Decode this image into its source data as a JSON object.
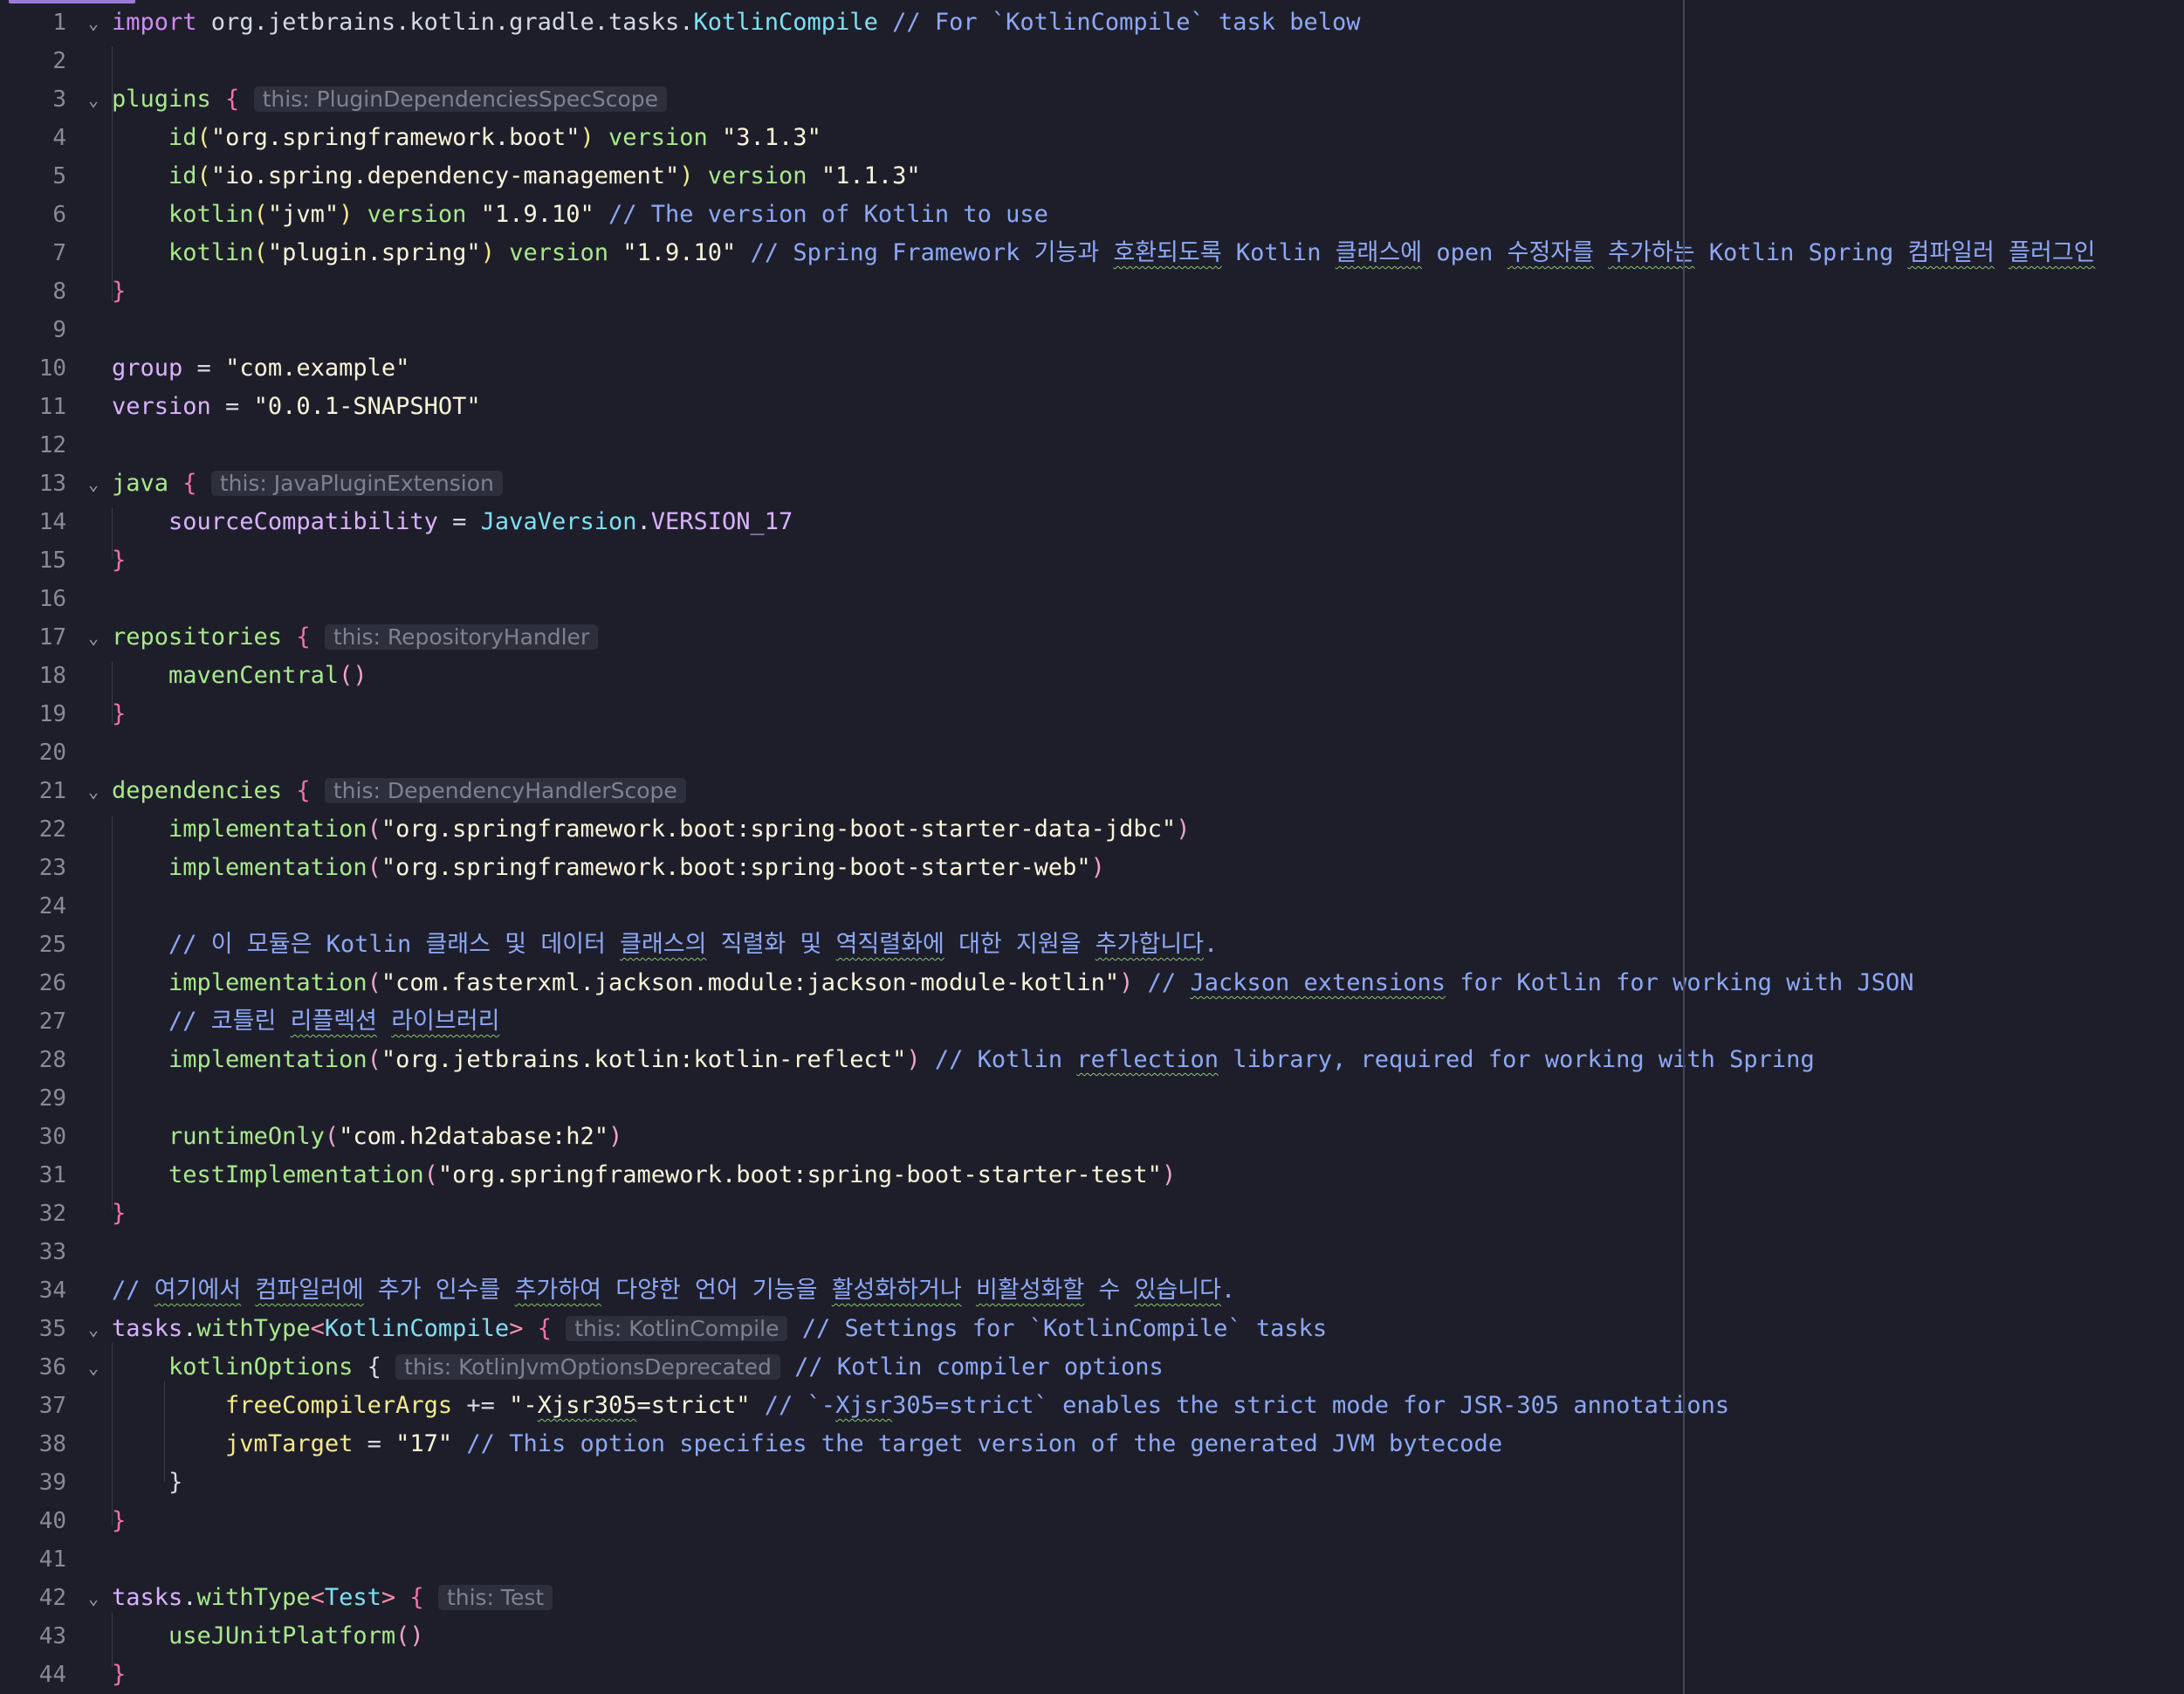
{
  "editor": {
    "line_numbers": [
      "1",
      "2",
      "3",
      "4",
      "5",
      "6",
      "7",
      "8",
      "9",
      "10",
      "11",
      "12",
      "13",
      "14",
      "15",
      "16",
      "17",
      "18",
      "19",
      "20",
      "21",
      "22",
      "23",
      "24",
      "25",
      "26",
      "27",
      "28",
      "29",
      "30",
      "31",
      "32",
      "33",
      "34",
      "35",
      "36",
      "37",
      "38",
      "39",
      "40",
      "41",
      "42",
      "43",
      "44"
    ],
    "code": {
      "l1": {
        "kw": "import",
        "pkg": " org.jetbrains.kotlin.gradle.tasks.",
        "cls": "KotlinCompile",
        "cm": " // For `KotlinCompile` task below"
      },
      "l3": {
        "name": "plugins",
        "brace": " {",
        "hint": "this: PluginDependenciesSpecScope"
      },
      "l4": {
        "fn": "id",
        "po": "(",
        "str": "\"org.springframework.boot\"",
        "pc": ")",
        "kw": " version ",
        "ver": "\"3.1.3\""
      },
      "l5": {
        "fn": "id",
        "po": "(",
        "str": "\"io.spring.dependency-management\"",
        "pc": ")",
        "kw": " version ",
        "ver": "\"1.1.3\""
      },
      "l6": {
        "fn": "kotlin",
        "po": "(",
        "str": "\"jvm\"",
        "pc": ")",
        "kw": " version ",
        "ver": "\"1.9.10\"",
        "cm": " // The version of Kotlin to use"
      },
      "l7": {
        "fn": "kotlin",
        "po": "(",
        "str": "\"plugin.spring\"",
        "pc": ")",
        "kw": " version ",
        "ver": "\"1.9.10\"",
        "c1": " // Spring Framework 기능과 ",
        "w1": "호환되도록",
        "c2": " Kotlin ",
        "w2": "클래스에",
        "c3": " open ",
        "w3": "수정자를",
        "c4": " ",
        "w4": "추가하는",
        "c5": " Kotlin Spring ",
        "w5": "컴파일러",
        "c6": " ",
        "w6": "플러그인"
      },
      "l8": {
        "brace": "}"
      },
      "l10": {
        "prop": "group",
        "eq": " = ",
        "str": "\"com.example\""
      },
      "l11": {
        "prop": "version",
        "eq": " = ",
        "str": "\"0.0.1-SNAPSHOT\""
      },
      "l13": {
        "name": "java",
        "brace": " {",
        "hint": "this: JavaPluginExtension"
      },
      "l14": {
        "prop": "sourceCompatibility",
        "eq": " = ",
        "cls": "JavaVersion",
        "dot": ".",
        "const": "VERSION_17"
      },
      "l15": {
        "brace": "}"
      },
      "l17": {
        "name": "repositories",
        "brace": " {",
        "hint": "this: RepositoryHandler"
      },
      "l18": {
        "fn": "mavenCentral",
        "parens": "()"
      },
      "l19": {
        "brace": "}"
      },
      "l21": {
        "name": "dependencies",
        "brace": " {",
        "hint": "this: DependencyHandlerScope"
      },
      "l22": {
        "fn": "implementation",
        "po": "(",
        "str": "\"org.springframework.boot:spring-boot-starter-data-jdbc\"",
        "pc": ")"
      },
      "l23": {
        "fn": "implementation",
        "po": "(",
        "str": "\"org.springframework.boot:spring-boot-starter-web\"",
        "pc": ")"
      },
      "l25": {
        "c1": "// 이 모듈은 Kotlin 클래스 및 데이터 ",
        "w1": "클래스의",
        "c2": " 직렬화 및 ",
        "w2": "역직렬화에",
        "c3": " 대한 지원을 ",
        "w3": "추가합니다",
        "c4": "."
      },
      "l26": {
        "fn": "implementation",
        "po": "(",
        "str": "\"com.fasterxml.jackson.module:jackson-module-kotlin\"",
        "pc": ")",
        "c1": " // ",
        "w1": "Jackson extensions",
        "c2": " for Kotlin for working with JSON"
      },
      "l27": {
        "c1": "// 코틀린 ",
        "w1": "리플렉션",
        "c2": " ",
        "w2": "라이브러리"
      },
      "l28": {
        "fn": "implementation",
        "po": "(",
        "str": "\"org.jetbrains.kotlin:kotlin-reflect\"",
        "pc": ")",
        "c1": " // Kotlin ",
        "w1": "reflection",
        "c2": " library, required for working with Spring"
      },
      "l30": {
        "fn": "runtimeOnly",
        "po": "(",
        "str": "\"com.h2database:h2\"",
        "pc": ")"
      },
      "l31": {
        "fn": "testImplementation",
        "po": "(",
        "str": "\"org.springframework.boot:spring-boot-starter-test\"",
        "pc": ")"
      },
      "l32": {
        "brace": "}"
      },
      "l34": {
        "c1": "// ",
        "w1": "여기에서",
        "c2": " ",
        "w2": "컴파일러에",
        "c3": " 추가 인수를 ",
        "w3": "추가하여",
        "c4": " 다양한 언어 기능을 ",
        "w4": "활성화하거나",
        "c5": " ",
        "w5": "비활성화할",
        "c6": " 수 ",
        "w6": "있습니다",
        "c7": "."
      },
      "l35": {
        "obj": "tasks",
        "dot": ".",
        "fn": "withType",
        "lt": "<",
        "cls": "KotlinCompile",
        "gt": ">",
        "brace": " {",
        "hint": "this: KotlinCompile",
        "cm": " // Settings for `KotlinCompile` tasks"
      },
      "l36": {
        "name": "kotlinOptions",
        "brace": " {",
        "hint": "this: KotlinJvmOptionsDeprecated",
        "cm": " // Kotlin compiler options"
      },
      "l37": {
        "prop": "freeCompilerArgs",
        "op": " += ",
        "s1": "\"-",
        "sw": "Xjsr305",
        "s2": "=strict\"",
        "c1": " // `-",
        "cw": "Xjsr",
        "c2": "305=strict` enables the strict mode for JSR-305 annotations"
      },
      "l38": {
        "prop": "jvmTarget",
        "eq": " = ",
        "str": "\"17\"",
        "cm": " // This option specifies the target version of the generated JVM bytecode"
      },
      "l39": {
        "brace": "}"
      },
      "l40": {
        "brace": "}"
      },
      "l42": {
        "obj": "tasks",
        "dot": ".",
        "fn": "withType",
        "lt": "<",
        "cls": "Test",
        "gt": ">",
        "brace": " {",
        "hint": "this: Test"
      },
      "l43": {
        "fn": "useJUnitPlatform",
        "parens": "()"
      },
      "l44": {
        "brace": "}"
      }
    },
    "fold_icon": "chevron-down-icon",
    "colors": {
      "background": "#1e1e2b",
      "keyword": "#cf8af5",
      "function": "#a8e98a",
      "type": "#7ee0f2",
      "string": "#fbf6d8",
      "comment": "#8da9f6",
      "brace": "#f472a8",
      "inlay_hint_bg": "#2e2f3c",
      "line_number": "#8a8a96"
    }
  }
}
